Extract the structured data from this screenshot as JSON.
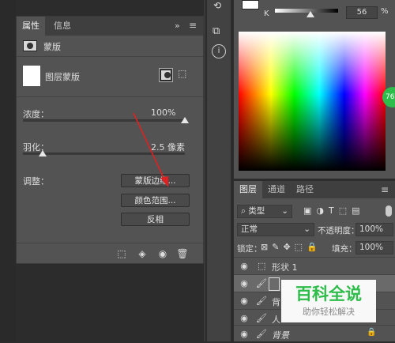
{
  "properties_panel": {
    "tabs": [
      {
        "label": "属性"
      },
      {
        "label": "信息"
      }
    ],
    "expand_icon": "double-chevron-right-icon",
    "menu_icon": "hamburger-icon",
    "section_title": "蒙版",
    "mask_label": "图层蒙版",
    "density": {
      "label": "浓度：",
      "value": "100%",
      "level": 1.0
    },
    "feather": {
      "label": "羽化：",
      "value": "2.5 像素",
      "level": 0.12
    },
    "adjust_label": "调整：",
    "buttons": {
      "mask_edge": "蒙版边缘...",
      "color_range": "颜色范围...",
      "invert": "反相"
    }
  },
  "color_panel": {
    "k_label": "K",
    "k_value": "56",
    "k_unit": "%",
    "k_level": 0.56,
    "side_badge": "76",
    "accent": "#2ebd4a"
  },
  "layers_panel": {
    "tabs": [
      {
        "label": "图层"
      },
      {
        "label": "通道"
      },
      {
        "label": "路径"
      }
    ],
    "filter_label": "类型",
    "blend_mode": "正常",
    "opacity_label": "不透明度：",
    "opacity_value": "100%",
    "lock_label": "锁定：",
    "fill_label": "填充：",
    "fill_value": "100%",
    "layers": [
      {
        "name": "形状 1"
      },
      {
        "name": ""
      },
      {
        "name": "背"
      },
      {
        "name": "人"
      },
      {
        "name": "背景"
      }
    ]
  },
  "watermark": {
    "main": "百科全说",
    "sub": "助你轻松解决"
  }
}
